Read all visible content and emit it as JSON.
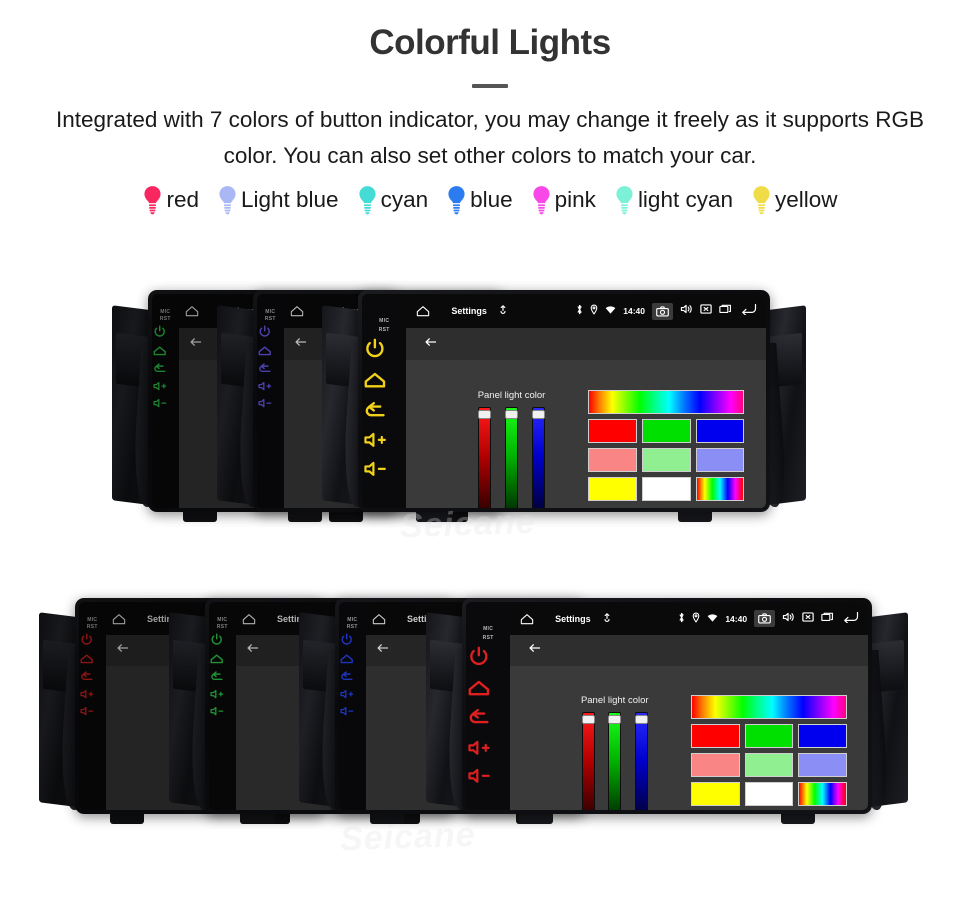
{
  "hero": {
    "title": "Colorful Lights",
    "subtitle": "Integrated with 7 colors of button indicator, you may change it freely as it supports RGB color. You can also set other colors to match your car."
  },
  "legend": {
    "items": [
      {
        "label": "red",
        "color": "#f8275f"
      },
      {
        "label": "Light blue",
        "color": "#a9b8f5"
      },
      {
        "label": "cyan",
        "color": "#45dcd6"
      },
      {
        "label": "blue",
        "color": "#2b7cf0"
      },
      {
        "label": "pink",
        "color": "#f848e8"
      },
      {
        "label": "light cyan",
        "color": "#7df0d8"
      },
      {
        "label": "yellow",
        "color": "#f0dc46"
      }
    ]
  },
  "device": {
    "screen": {
      "status_bar": {
        "title": "Settings",
        "clock": "14:40",
        "icons": [
          "home-icon",
          "mic-icon",
          "bluetooth-icon",
          "location-icon",
          "wifi-icon",
          "camera-icon",
          "speaker-icon",
          "close-box-icon",
          "recents-icon",
          "back-icon"
        ]
      },
      "action_bar": {
        "back": "back-arrow-icon"
      },
      "panel": {
        "caption": "Panel light color",
        "sliders": [
          {
            "name": "red-slider",
            "color": "#ff1a1a",
            "value": 93
          },
          {
            "name": "green-slider",
            "color": "#19ff19",
            "value": 93
          },
          {
            "name": "blue-slider",
            "color": "#2a2aff",
            "value": 93
          }
        ],
        "swatch_rows": [
          [
            "#ff0000",
            "#00e000",
            "#0000ee"
          ],
          [
            "#fa8585",
            "#90ef90",
            "#8a8ef5"
          ],
          [
            "#ffff00",
            "#ffffff",
            "rainbow"
          ]
        ]
      }
    },
    "hardware_buttons": {
      "mic_label": "MIC",
      "reset_label": "RST",
      "icons": [
        "power-icon",
        "home-icon",
        "back-icon",
        "volume-up-icon",
        "volume-down-icon"
      ]
    }
  },
  "groups": [
    {
      "name": "top-device-group",
      "watermark": "Seicane",
      "units": [
        {
          "name": "unit-green",
          "led": "#2fd14a",
          "front": false
        },
        {
          "name": "unit-purple",
          "led": "#6b5bf0",
          "front": false
        },
        {
          "name": "unit-yellow",
          "led": "#f2d218",
          "front": true
        }
      ]
    },
    {
      "name": "bottom-device-group",
      "watermark": "Seicane",
      "units": [
        {
          "name": "unit-red",
          "led": "#e02020",
          "front": false
        },
        {
          "name": "unit-green",
          "led": "#2fd14a",
          "front": false
        },
        {
          "name": "unit-blue",
          "led": "#2442ef",
          "front": false
        },
        {
          "name": "unit-red-front",
          "led": "#e02020",
          "front": true
        }
      ]
    }
  ]
}
